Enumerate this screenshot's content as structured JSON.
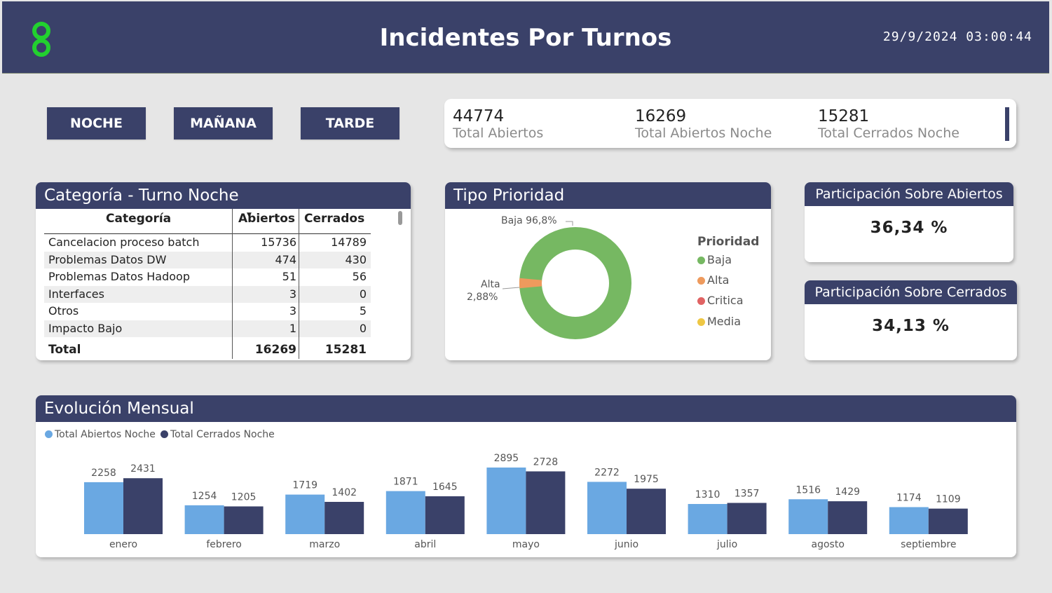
{
  "header": {
    "title": "Incidentes Por Turnos",
    "datetime": "29/9/2024  03:00:44",
    "logo_icon": "green-figure-eight-logo"
  },
  "shifts": [
    {
      "label": "NOCHE"
    },
    {
      "label": "MAÑANA"
    },
    {
      "label": "TARDE"
    }
  ],
  "kpis": [
    {
      "value": "44774",
      "label": "Total Abiertos"
    },
    {
      "value": "16269",
      "label": "Total Abiertos Noche"
    },
    {
      "value": "15281",
      "label": "Total Cerrados Noche"
    }
  ],
  "category": {
    "title": "Categoría - Turno Noche",
    "columns": [
      "Categoría",
      "Abiertos",
      "Cerrados"
    ],
    "rows": [
      {
        "name": "Cancelacion proceso batch",
        "abiertos": "15736",
        "cerrados": "14789"
      },
      {
        "name": "Problemas Datos DW",
        "abiertos": "474",
        "cerrados": "430"
      },
      {
        "name": "Problemas Datos Hadoop",
        "abiertos": "51",
        "cerrados": "56"
      },
      {
        "name": "Interfaces",
        "abiertos": "3",
        "cerrados": "0"
      },
      {
        "name": "Otros",
        "abiertos": "3",
        "cerrados": "5"
      },
      {
        "name": "Impacto Bajo",
        "abiertos": "1",
        "cerrados": "0"
      }
    ],
    "total": {
      "label": "Total",
      "abiertos": "16269",
      "cerrados": "15281"
    }
  },
  "priority": {
    "title": "Tipo Prioridad",
    "legend_title": "Prioridad",
    "legend": [
      {
        "label": "Baja",
        "color": "#76b862"
      },
      {
        "label": "Alta",
        "color": "#ee9a5d"
      },
      {
        "label": "Critica",
        "color": "#e06363"
      },
      {
        "label": "Media",
        "color": "#eec744"
      }
    ],
    "label_baja": "Baja 96,8%",
    "label_alta_1": "Alta",
    "label_alta_2": "2,88%",
    "slices": [
      {
        "name": "Baja",
        "value": 96.8
      },
      {
        "name": "Alta",
        "value": 2.88
      }
    ]
  },
  "participation": [
    {
      "title": "Participación Sobre Abiertos",
      "value": "36,34 %"
    },
    {
      "title": "Participación Sobre Cerrados",
      "value": "34,13 %"
    }
  ],
  "chart_data": {
    "type": "bar",
    "title": "Evolución Mensual",
    "categories": [
      "enero",
      "febrero",
      "marzo",
      "abril",
      "mayo",
      "junio",
      "julio",
      "agosto",
      "septiembre"
    ],
    "series": [
      {
        "name": "Total Abiertos Noche",
        "color": "#6aa8e2",
        "values": [
          2258,
          1254,
          1719,
          1871,
          2895,
          2272,
          1310,
          1516,
          1174
        ]
      },
      {
        "name": "Total Cerrados Noche",
        "color": "#3a4169",
        "values": [
          2431,
          1205,
          1402,
          1645,
          2728,
          1975,
          1357,
          1429,
          1109
        ]
      }
    ],
    "legend_position": "top-left"
  }
}
